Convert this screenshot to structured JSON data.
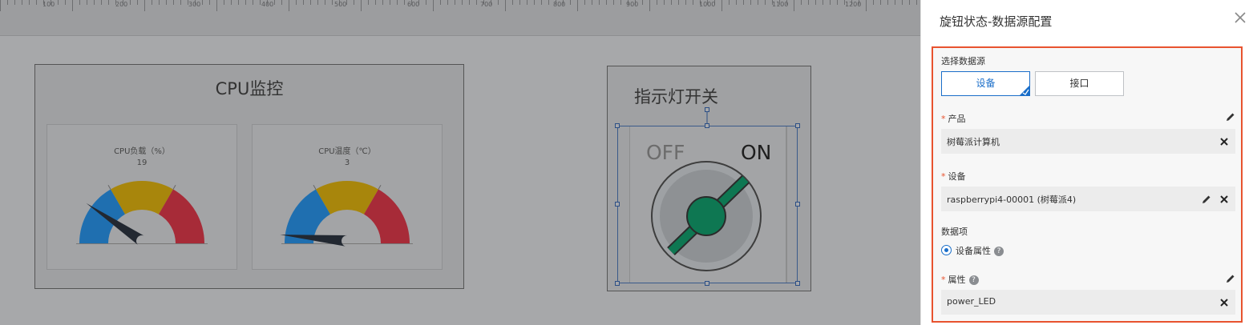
{
  "ruler": {
    "labels": [
      "100",
      "200",
      "300",
      "400",
      "500",
      "600",
      "700",
      "800",
      "900",
      "1000",
      "1100",
      "1200"
    ]
  },
  "canvas": {
    "cpu_panel": {
      "title": "CPU监控",
      "gauges": [
        {
          "label": "CPU负载（%）",
          "value": "19",
          "needle_fraction": 0.19
        },
        {
          "label": "CPU温度（℃）",
          "value": "3",
          "needle_fraction": 0.03
        }
      ],
      "colors": {
        "low": "#1f6fb0",
        "mid": "#a8860c",
        "high": "#a72b38",
        "needle": "#222831"
      }
    },
    "led_panel": {
      "title": "指示灯开关",
      "off_label": "OFF",
      "on_label": "ON",
      "state": "ON",
      "colors": {
        "knob": "#0e7752",
        "dial": "#8e9194"
      }
    }
  },
  "config": {
    "title": "旋钮状态-数据源配置",
    "close_icon": "close-icon",
    "source_label": "选择数据源",
    "source_options": {
      "device": "设备",
      "api": "接口"
    },
    "selected_source": "设备",
    "product": {
      "label": "产品",
      "required": "*",
      "value": "树莓派计算机"
    },
    "device": {
      "label": "设备",
      "required": "*",
      "value": "raspberrypi4-00001 (树莓派4)"
    },
    "data_item": {
      "label": "数据项",
      "option": "设备属性",
      "help": "?"
    },
    "attribute": {
      "label": "属性",
      "required": "*",
      "help": "?",
      "value": "power_LED"
    },
    "colors": {
      "accent": "#1a6ec9",
      "highlight": "#e8532f"
    }
  }
}
